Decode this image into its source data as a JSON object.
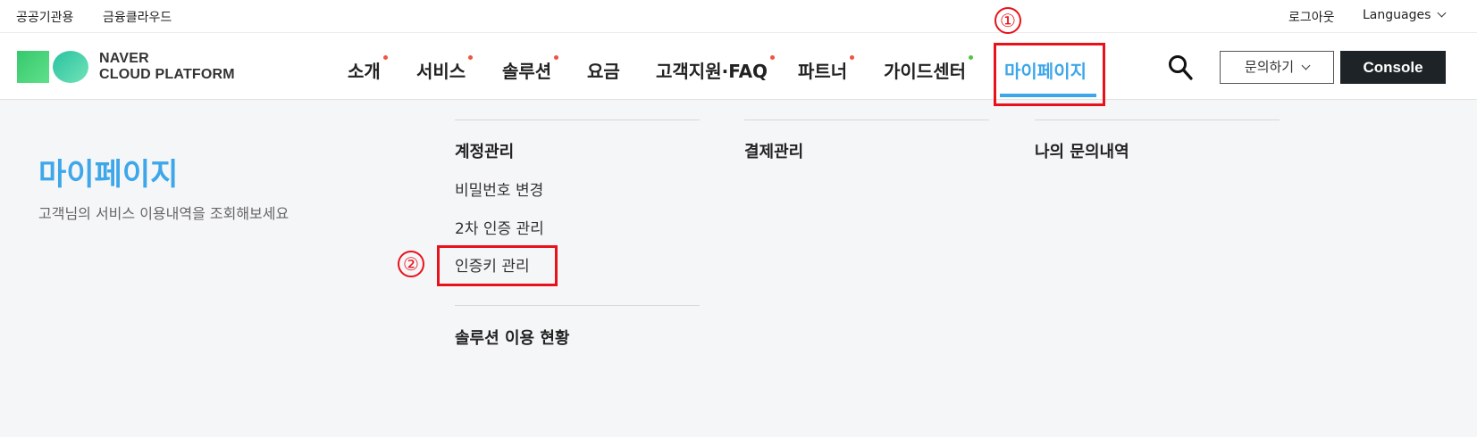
{
  "util_bar": {
    "left_links": [
      "공공기관용",
      "금융클라우드"
    ],
    "logout": "로그아웃",
    "languages": "Languages"
  },
  "logo": {
    "line1": "NAVER",
    "line2": "CLOUD PLATFORM"
  },
  "nav": {
    "items": [
      {
        "label": "소개",
        "badge": "new"
      },
      {
        "label": "서비스",
        "badge": "new"
      },
      {
        "label": "솔루션",
        "badge": "new"
      },
      {
        "label": "요금",
        "badge": ""
      },
      {
        "label": "고객지원·FAQ",
        "badge": "new"
      },
      {
        "label": "파트너",
        "badge": "new"
      },
      {
        "label": "가이드센터",
        "badge": "green"
      },
      {
        "label": "마이페이지",
        "badge": "",
        "active": true
      }
    ],
    "search_icon": "search-icon",
    "inquiry_label": "문의하기",
    "console_label": "Console"
  },
  "annotations": {
    "step1": "①",
    "step2": "②",
    "color": "#e8121b"
  },
  "mega_menu": {
    "title": "마이페이지",
    "description": "고객님의 서비스 이용내역을 조회해보세요",
    "columns": [
      {
        "heading": "계정관리",
        "links": [
          "비밀번호 변경",
          "2차 인증 관리",
          "인증키 관리"
        ]
      },
      {
        "heading": "결제관리",
        "links": []
      },
      {
        "heading": "나의 문의내역",
        "links": []
      }
    ],
    "extra_heading": "솔루션 이용 현황"
  },
  "colors": {
    "accent": "#3ea7e9",
    "console_bg": "#1e2327",
    "badge_dot": "#f05340",
    "badge_green": "#4ec63f"
  }
}
